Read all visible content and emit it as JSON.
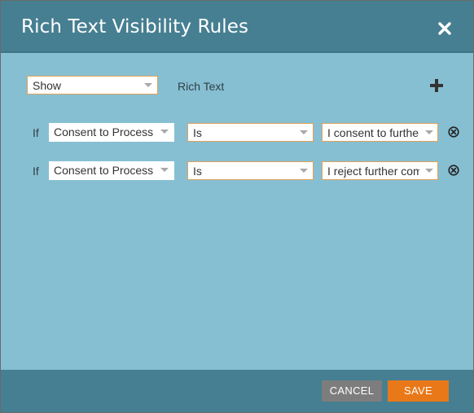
{
  "dialog": {
    "title": "Rich Text Visibility Rules",
    "close_icon": "close-icon"
  },
  "top_row": {
    "action_select": "Show",
    "target_label": "Rich Text",
    "add_icon": "plus-icon"
  },
  "rules": [
    {
      "if_label": "If",
      "field": "Consent to Processing",
      "operator": "Is",
      "value": "I consent to further processing",
      "remove_icon": "remove-circle-icon"
    },
    {
      "if_label": "If",
      "field": "Consent to Processing",
      "operator": "Is",
      "value": "I reject further communication",
      "remove_icon": "remove-circle-icon"
    }
  ],
  "footer": {
    "cancel_label": "CANCEL",
    "save_label": "SAVE"
  },
  "colors": {
    "header": "#467f91",
    "body": "#87bfd2",
    "save": "#e97818",
    "cancel": "#7d7d7d",
    "select_border": "#e0a25a"
  }
}
